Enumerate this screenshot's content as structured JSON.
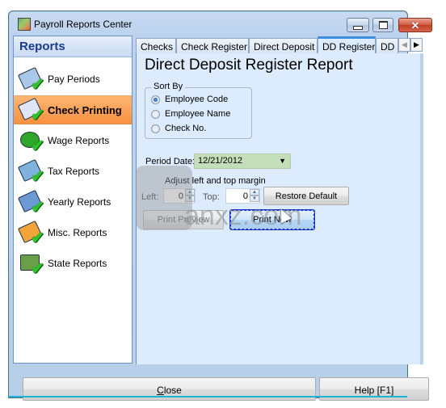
{
  "window": {
    "title": "Payroll Reports Center",
    "controls": {
      "minimize": "minimize",
      "maximize": "maximize",
      "close": "✕"
    }
  },
  "sidebar": {
    "header": "Reports",
    "items": [
      {
        "label": "Pay Periods",
        "icon": "pay-periods-icon",
        "active": false,
        "color": "#8fb3d9"
      },
      {
        "label": "Check Printing",
        "icon": "check-printing-icon",
        "active": true,
        "color": "#c7d5f2"
      },
      {
        "label": "Wage Reports",
        "icon": "wage-reports-icon",
        "active": false,
        "color": "#2ea62a"
      },
      {
        "label": "Tax Reports",
        "icon": "tax-reports-icon",
        "active": false,
        "color": "#6aa8d8"
      },
      {
        "label": "Yearly Reports",
        "icon": "yearly-reports-icon",
        "active": false,
        "color": "#5c8fd0"
      },
      {
        "label": "Misc. Reports",
        "icon": "misc-reports-icon",
        "active": false,
        "color": "#f2a33a"
      },
      {
        "label": "State Reports",
        "icon": "state-reports-icon",
        "active": false,
        "color": "#6a9f4a"
      }
    ]
  },
  "tabs": {
    "items": [
      {
        "label": "Checks",
        "active": false
      },
      {
        "label": "Check Register",
        "active": false
      },
      {
        "label": "Direct Deposit",
        "active": false
      },
      {
        "label": "DD Register",
        "active": true
      },
      {
        "label": "DD I",
        "active": false
      }
    ],
    "scroll_left": "◀",
    "scroll_right": "▶"
  },
  "panel": {
    "title": "Direct Deposit Register Report",
    "sort_by": {
      "legend": "Sort By",
      "options": [
        {
          "label": "Employee Code",
          "checked": true
        },
        {
          "label": "Employee Name",
          "checked": false
        },
        {
          "label": "Check No.",
          "checked": false
        }
      ]
    },
    "period_date": {
      "label": "Period Date:",
      "value": "12/21/2012",
      "arrow": "▼"
    },
    "margin": {
      "heading": "Adjust left and top margin",
      "left_label": "Left:",
      "left_value": "0",
      "top_label": "Top:",
      "top_value": "0",
      "spin_up": "▲",
      "spin_down": "▼"
    },
    "buttons": {
      "restore_default": "Restore Default",
      "print_preview": "Print Preview",
      "print_now": "Print Now"
    },
    "watermark": "anxz.com"
  },
  "footer": {
    "close_mnemonic": "C",
    "close_rest": "lose",
    "help": "Help [F1]"
  },
  "colors": {
    "active_item": "#f7913f",
    "active_tab_accent": "#3d8de0",
    "panel_bg": "#dcebfd",
    "period_date_bg": "#c4deb9",
    "sidebar_header_text": "#1b3a8c"
  }
}
